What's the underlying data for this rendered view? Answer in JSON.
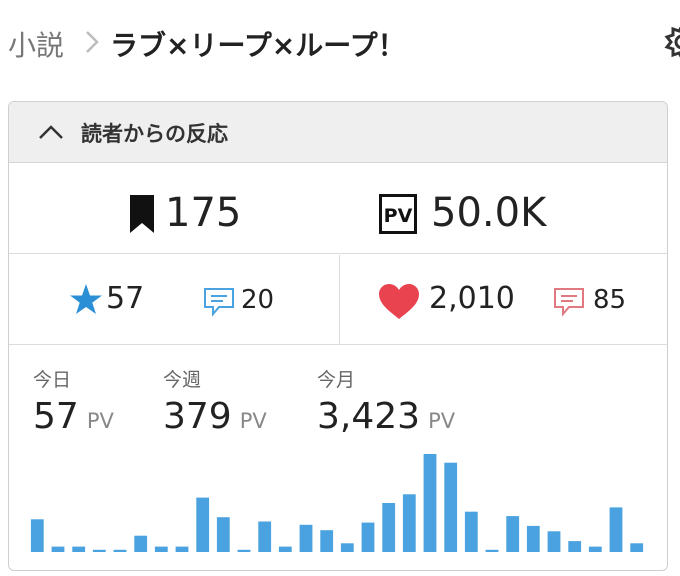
{
  "header": {
    "breadcrumb_root": "小説",
    "title": "ラブ×リープ×ループ！",
    "settings_icon": "gear-icon"
  },
  "panel": {
    "title": "読者からの反応",
    "collapse_icon": "chevron-up-icon",
    "bookmarks": {
      "icon": "bookmark-icon",
      "value": "175"
    },
    "pageviews": {
      "icon": "pv-icon",
      "value": "50.0K"
    },
    "stars": {
      "icon": "star-icon",
      "value": "57"
    },
    "star_comments": {
      "icon": "comment-icon",
      "value": "20"
    },
    "hearts": {
      "icon": "heart-icon",
      "value": "2,010"
    },
    "heart_comments": {
      "icon": "comment-icon",
      "value": "85"
    },
    "pv_stats": [
      {
        "label": "今日",
        "value": "57",
        "unit": "PV"
      },
      {
        "label": "今週",
        "value": "379",
        "unit": "PV"
      },
      {
        "label": "今月",
        "value": "3,423",
        "unit": "PV"
      }
    ]
  },
  "colors": {
    "accent_blue": "#4aa3e0",
    "heart_red": "#e8434f",
    "comment_red": "#e07a80",
    "bar_blue": "#4aa3e0"
  },
  "chart_data": {
    "type": "bar",
    "values": [
      30,
      5,
      5,
      2,
      2,
      15,
      5,
      5,
      50,
      32,
      2,
      28,
      5,
      25,
      20,
      8,
      27,
      45,
      53,
      90,
      82,
      37,
      2,
      33,
      24,
      19,
      10,
      5,
      41,
      8
    ],
    "grid": false
  }
}
